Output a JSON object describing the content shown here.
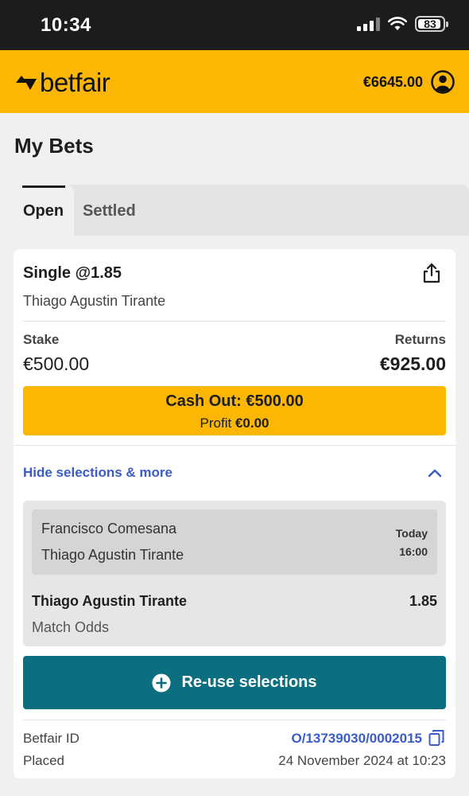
{
  "status_bar": {
    "time": "10:34",
    "battery": "83",
    "icons": [
      "signal-icon",
      "wifi-icon",
      "battery-icon"
    ]
  },
  "header": {
    "brand": "betfair",
    "balance": "€6645.00",
    "brand_color": "#fcb705",
    "icons": [
      "betfair-logo-icon",
      "account-icon"
    ]
  },
  "page": {
    "title": "My Bets"
  },
  "tabs": [
    {
      "label": "Open",
      "active": true
    },
    {
      "label": "Settled",
      "active": false
    }
  ],
  "bet": {
    "type": "Single @1.85",
    "runner": "Thiago Agustin Tirante",
    "stake_label": "Stake",
    "stake": "€500.00",
    "returns_label": "Returns",
    "returns": "€925.00",
    "cash_out_label": "Cash Out: €500.00",
    "profit_label": "Profit",
    "profit_value": "€0.00",
    "hide_selections": "Hide selections & more",
    "selection": {
      "home": "Francisco Comesana",
      "away": "Thiago Agustin Tirante",
      "day": "Today",
      "time": "16:00",
      "runner": "Thiago Agustin Tirante",
      "odds": "1.85",
      "market": "Match Odds"
    },
    "reuse_label": "Re-use selections",
    "id_label": "Betfair ID",
    "id_value": "O/13739030/0002015",
    "placed_label": "Placed",
    "placed_value": "24 November 2024 at 10:23"
  },
  "colors": {
    "accent_yellow": "#fcb705",
    "teal_button": "#0c6f80",
    "link_blue": "#3a5cc5"
  }
}
